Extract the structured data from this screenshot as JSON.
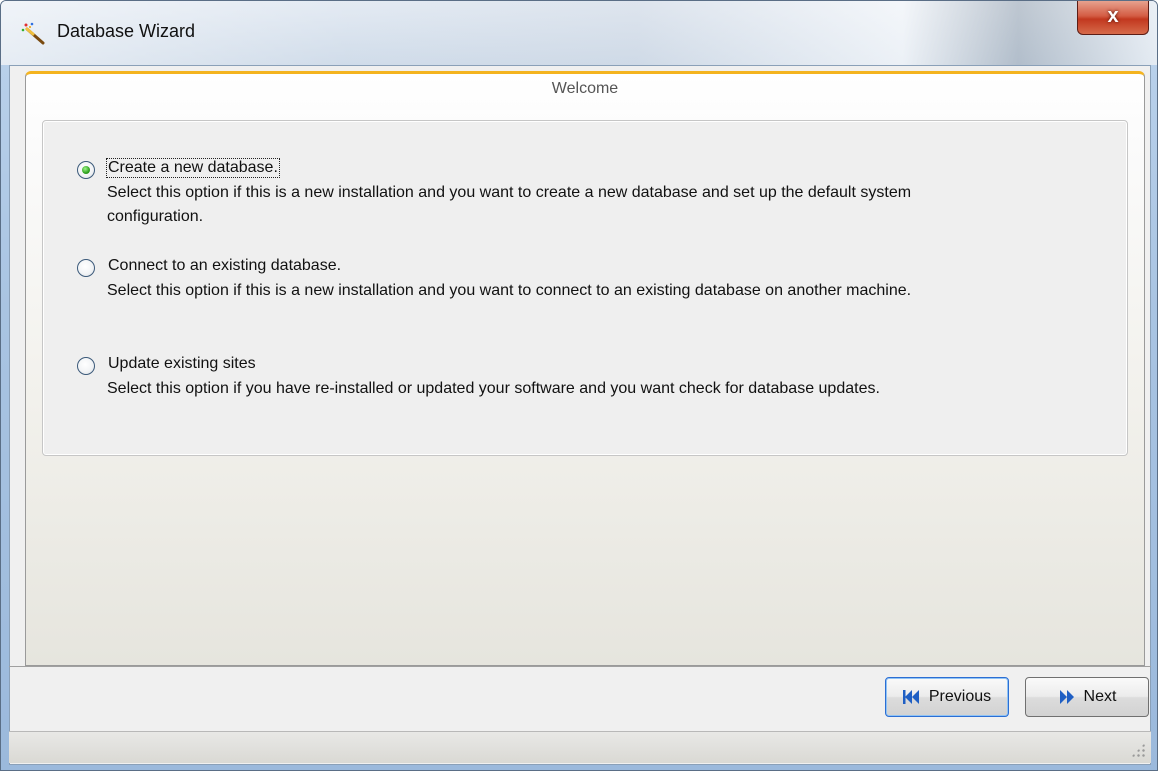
{
  "window": {
    "title": "Database Wizard",
    "close_symbol": "x"
  },
  "header": {
    "title": "Welcome"
  },
  "options": [
    {
      "label": "Create a new database.",
      "description": "Select this option if this is a new installation and you want to create a new database and set up the default system configuration.",
      "selected": true
    },
    {
      "label": "Connect to an existing database.",
      "description": "Select this option if this is a new installation and you want to connect to an existing database on another machine.",
      "selected": false
    },
    {
      "label": "Update existing sites",
      "description": "Select this option if you have re-installed or updated your software and you want check for database updates.",
      "selected": false
    }
  ],
  "buttons": {
    "previous_label": "Previous",
    "next_label": "Next"
  },
  "icons": {
    "title": "wand-icon",
    "previous": "rewind-icon",
    "next": "fast-forward-icon"
  },
  "colors": {
    "header_accent": "#f4b420",
    "selected_radio": "#2fa21f",
    "button_icon": "#1f5fc4"
  }
}
